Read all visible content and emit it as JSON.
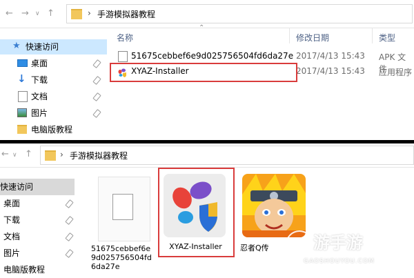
{
  "top": {
    "path": "手游模拟器教程",
    "sidebar": [
      {
        "label": "快速访问",
        "pinned": false
      },
      {
        "label": "桌面",
        "pinned": true
      },
      {
        "label": "下载",
        "pinned": true
      },
      {
        "label": "文档",
        "pinned": true
      },
      {
        "label": "图片",
        "pinned": true
      },
      {
        "label": "电脑版教程",
        "pinned": false
      }
    ],
    "columns": {
      "name": "名称",
      "date": "修改日期",
      "type": "类型"
    },
    "files": [
      {
        "name": "51675cebbef6e9d025756504fd6da27e",
        "date": "2017/4/13 15:43",
        "type": "APK 文件"
      },
      {
        "name": "XYAZ-Installer",
        "date": "2017/4/13 15:43",
        "type": "应用程序"
      }
    ]
  },
  "bottom": {
    "path": "手游模拟器教程",
    "sidebar": [
      {
        "label": "快速访问",
        "pinned": false
      },
      {
        "label": "桌面",
        "pinned": true
      },
      {
        "label": "下载",
        "pinned": true
      },
      {
        "label": "文档",
        "pinned": true
      },
      {
        "label": "图片",
        "pinned": true
      },
      {
        "label": "电脑版教程",
        "pinned": false
      }
    ],
    "icons": [
      {
        "label_lines": [
          "51675cebbef6e",
          "9d025756504fd",
          "6da27e"
        ]
      },
      {
        "label_lines": [
          "XYAZ-Installer"
        ]
      },
      {
        "label_lines": [
          "忍者Q传"
        ]
      }
    ]
  },
  "watermark": {
    "brand": "游手游",
    "url": "GAOSHOUYOU.COM"
  },
  "colors": {
    "highlight_red": "#d93b3b",
    "sidebar_selected": "#cce8ff"
  }
}
